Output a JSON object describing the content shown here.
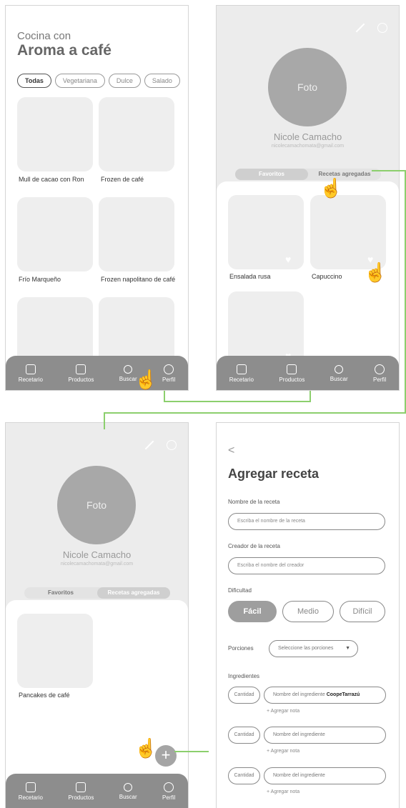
{
  "screen1": {
    "subtitle": "Cocina con",
    "title": "Aroma a café",
    "filters": [
      "Todas",
      "Vegetariana",
      "Dulce",
      "Salado"
    ],
    "cards": [
      "Mull de cacao con Ron",
      "Frozen de café",
      "Frío Marqueño",
      "Frozen napolitano de café"
    ]
  },
  "nav": {
    "recetario": "Recetario",
    "productos": "Productos",
    "buscar": "Buscar",
    "perfil": "Perfil"
  },
  "profile": {
    "photo_label": "Foto",
    "name": "Nicole Camacho",
    "email": "nicolecamachomata@gmail.com",
    "tab_favorites": "Favoritos",
    "tab_added": "Recetas agregadas"
  },
  "screen2": {
    "cards": [
      "Ensalada rusa",
      "Capuccino"
    ]
  },
  "screen3": {
    "cards": [
      "Pancakes de café"
    ],
    "fab": "+"
  },
  "screen4": {
    "back": "<",
    "title": "Agregar receta",
    "recipe_name_label": "Nombre de la receta",
    "recipe_name_placeholder": "Escriba el nombre de la receta",
    "creator_label": "Creador de la receta",
    "creator_placeholder": "Escriba el nombre del creador",
    "difficulty_label": "Dificultad",
    "difficulty": [
      "Fácil",
      "Medio",
      "Difícil"
    ],
    "difficulty_selected": "Fácil",
    "portions_label": "Porciones",
    "portions_placeholder": "Seleccione las porciones",
    "ingredients_label": "Ingredientes",
    "quantity": "Cantidad",
    "ingredient_placeholder": "Nombre del ingrediente",
    "ingredient_brand": "CoopeTarrazú",
    "add_note": "+ Agregar nota"
  },
  "colors": {
    "connector": "#8ccf6d",
    "nav": "#8d8d8d"
  }
}
